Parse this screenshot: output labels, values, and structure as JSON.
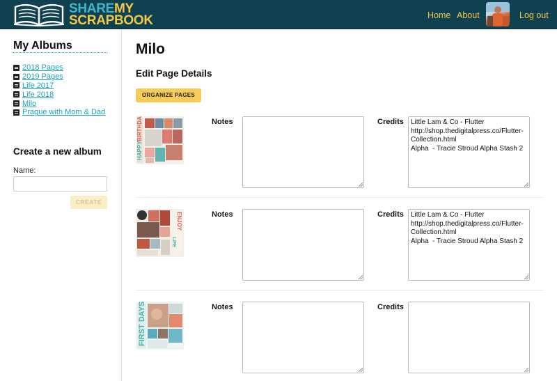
{
  "header": {
    "logo": {
      "share": "SHARE",
      "my": "MY",
      "scrapbook": "SCRAPBOOK"
    },
    "nav": {
      "home": "Home",
      "about": "About",
      "logout": "Log out"
    }
  },
  "sidebar": {
    "title": "My Albums",
    "albums": [
      {
        "label": "2018 Pages"
      },
      {
        "label": "2019 Pages"
      },
      {
        "label": "Life 2017"
      },
      {
        "label": "Life 2018"
      },
      {
        "label": "Milo"
      },
      {
        "label": "Prague with Mom & Dad"
      }
    ],
    "create": {
      "title": "Create a new album",
      "name_label": "Name:",
      "name_value": "",
      "button": "CREATE"
    }
  },
  "main": {
    "title": "Milo",
    "subtitle": "Edit Page Details",
    "organize_button": "ORGANIZE PAGES",
    "pages": [
      {
        "notes_label": "Notes",
        "notes_value": "",
        "credits_label": "Credits",
        "credits_value": "Little Lam & Co - Flutter\nhttp://shop.thedigitalpress.co/Flutter-Collection.html\nAlpha  - Tracie Stroud Alpha Stash 2"
      },
      {
        "notes_label": "Notes",
        "notes_value": "",
        "credits_label": "Credits",
        "credits_value": "Little Lam & Co - Flutter\nhttp://shop.thedigitalpress.co/Flutter-Collection.html\nAlpha  - Tracie Stroud Alpha Stash 2"
      },
      {
        "notes_label": "Notes",
        "notes_value": "",
        "credits_label": "Credits",
        "credits_value": ""
      }
    ]
  },
  "colors": {
    "header_bg": "#0f4150",
    "accent_yellow": "#f7cc56",
    "link_teal": "#17a2b8"
  }
}
